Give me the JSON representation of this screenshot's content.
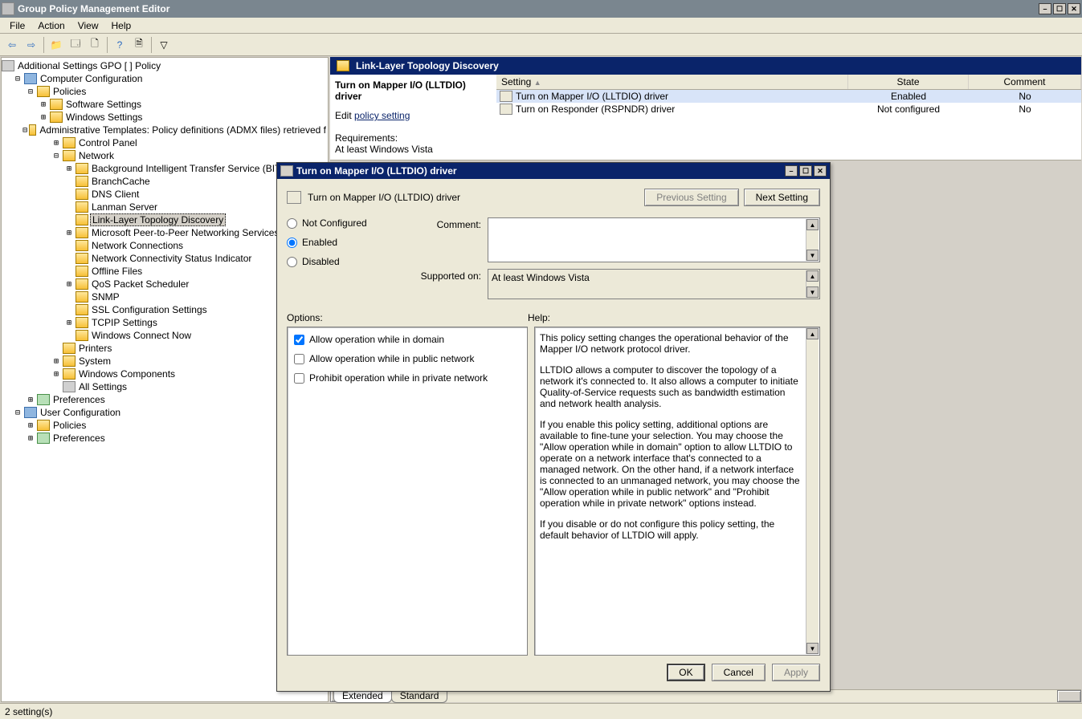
{
  "window": {
    "title": "Group Policy Management Editor"
  },
  "menu": [
    "File",
    "Action",
    "View",
    "Help"
  ],
  "toolbar_icons": [
    "back-icon",
    "forward-icon",
    "up-icon",
    "show-hide-icon",
    "properties-icon",
    "refresh-icon",
    "export-icon",
    "help-icon",
    "filter-options-icon",
    "filter-icon"
  ],
  "tree": {
    "root": "Additional Settings GPO [                                                 ] Policy",
    "nodes": [
      {
        "depth": 0,
        "tw": "-",
        "icon": "comp",
        "label": "Computer Configuration"
      },
      {
        "depth": 1,
        "tw": "-",
        "icon": "folder",
        "label": "Policies"
      },
      {
        "depth": 2,
        "tw": "+",
        "icon": "folder",
        "label": "Software Settings"
      },
      {
        "depth": 2,
        "tw": "+",
        "icon": "folder",
        "label": "Windows Settings"
      },
      {
        "depth": 2,
        "tw": "-",
        "icon": "folder",
        "label": "Administrative Templates: Policy definitions (ADMX files) retrieved f"
      },
      {
        "depth": 3,
        "tw": "+",
        "icon": "folder",
        "label": "Control Panel"
      },
      {
        "depth": 3,
        "tw": "-",
        "icon": "folder",
        "label": "Network"
      },
      {
        "depth": 4,
        "tw": "+",
        "icon": "folder",
        "label": "Background Intelligent Transfer Service (BITS"
      },
      {
        "depth": 4,
        "tw": " ",
        "icon": "folder",
        "label": "BranchCache"
      },
      {
        "depth": 4,
        "tw": " ",
        "icon": "folder",
        "label": "DNS Client"
      },
      {
        "depth": 4,
        "tw": " ",
        "icon": "folder",
        "label": "Lanman Server"
      },
      {
        "depth": 4,
        "tw": " ",
        "icon": "folder",
        "label": "Link-Layer Topology Discovery",
        "selected": true
      },
      {
        "depth": 4,
        "tw": "+",
        "icon": "folder",
        "label": "Microsoft Peer-to-Peer Networking Services"
      },
      {
        "depth": 4,
        "tw": " ",
        "icon": "folder",
        "label": "Network Connections"
      },
      {
        "depth": 4,
        "tw": " ",
        "icon": "folder",
        "label": "Network Connectivity Status Indicator"
      },
      {
        "depth": 4,
        "tw": " ",
        "icon": "folder",
        "label": "Offline Files"
      },
      {
        "depth": 4,
        "tw": "+",
        "icon": "folder",
        "label": "QoS Packet Scheduler"
      },
      {
        "depth": 4,
        "tw": " ",
        "icon": "folder",
        "label": "SNMP"
      },
      {
        "depth": 4,
        "tw": " ",
        "icon": "folder",
        "label": "SSL Configuration Settings"
      },
      {
        "depth": 4,
        "tw": "+",
        "icon": "folder",
        "label": "TCPIP Settings"
      },
      {
        "depth": 4,
        "tw": " ",
        "icon": "folder",
        "label": "Windows Connect Now"
      },
      {
        "depth": 3,
        "tw": " ",
        "icon": "folder",
        "label": "Printers"
      },
      {
        "depth": 3,
        "tw": "+",
        "icon": "folder",
        "label": "System"
      },
      {
        "depth": 3,
        "tw": "+",
        "icon": "folder",
        "label": "Windows Components"
      },
      {
        "depth": 3,
        "tw": " ",
        "icon": "gear",
        "label": "All Settings"
      },
      {
        "depth": 1,
        "tw": "+",
        "icon": "pref",
        "label": "Preferences"
      },
      {
        "depth": 0,
        "tw": "-",
        "icon": "comp",
        "label": "User Configuration"
      },
      {
        "depth": 1,
        "tw": "+",
        "icon": "folder",
        "label": "Policies"
      },
      {
        "depth": 1,
        "tw": "+",
        "icon": "pref",
        "label": "Preferences"
      }
    ]
  },
  "right": {
    "category_title": "Link-Layer Topology Discovery",
    "heading": "Turn on Mapper I/O (LLTDIO) driver",
    "edit_prefix": "Edit ",
    "edit_link": "policy setting",
    "req_label": "Requirements:",
    "req_value": "At least Windows Vista",
    "columns": {
      "setting": "Setting",
      "state": "State",
      "comment": "Comment"
    },
    "rows": [
      {
        "name": "Turn on Mapper I/O (LLTDIO) driver",
        "state": "Enabled",
        "comment": "No",
        "selected": true
      },
      {
        "name": "Turn on Responder (RSPNDR) driver",
        "state": "Not configured",
        "comment": "No"
      }
    ],
    "tabs": [
      "Extended",
      "Standard"
    ]
  },
  "dialog": {
    "title": "Turn on Mapper I/O (LLTDIO) driver",
    "heading": "Turn on Mapper I/O (LLTDIO) driver",
    "prev_btn": "Previous Setting",
    "next_btn": "Next Setting",
    "radios": {
      "not_configured": "Not Configured",
      "enabled": "Enabled",
      "disabled": "Disabled"
    },
    "selected_radio": "enabled",
    "comment_label": "Comment:",
    "supported_label": "Supported on:",
    "supported_value": "At least Windows Vista",
    "options_label": "Options:",
    "help_label": "Help:",
    "options": [
      {
        "label": "Allow operation while in domain",
        "checked": true
      },
      {
        "label": "Allow operation while in public network",
        "checked": false
      },
      {
        "label": "Prohibit operation while in private network",
        "checked": false
      }
    ],
    "help_paragraphs": [
      "This policy setting changes the operational behavior of the Mapper I/O network protocol driver.",
      "LLTDIO allows a computer to discover the topology of a network it's connected to. It also allows a computer to initiate Quality-of-Service requests such as bandwidth estimation and network health analysis.",
      "If you enable this policy setting, additional options are available to fine-tune your selection. You may choose the \"Allow operation while in domain\" option to allow LLTDIO to operate on a network interface that's connected to a managed network. On the other hand, if a network interface is connected to an unmanaged network, you may choose the \"Allow operation while in public network\" and \"Prohibit operation while in private network\" options instead.",
      "If you disable or do not configure this policy setting, the default behavior of LLTDIO will apply."
    ],
    "buttons": {
      "ok": "OK",
      "cancel": "Cancel",
      "apply": "Apply"
    }
  },
  "statusbar": "2 setting(s)"
}
